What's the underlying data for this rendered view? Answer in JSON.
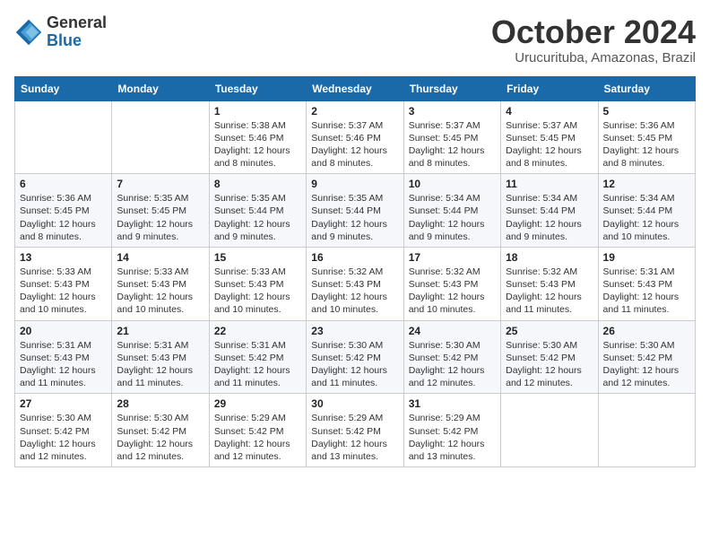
{
  "logo": {
    "general": "General",
    "blue": "Blue"
  },
  "title": "October 2024",
  "subtitle": "Urucurituba, Amazonas, Brazil",
  "headers": [
    "Sunday",
    "Monday",
    "Tuesday",
    "Wednesday",
    "Thursday",
    "Friday",
    "Saturday"
  ],
  "weeks": [
    [
      {
        "day": "",
        "info": ""
      },
      {
        "day": "",
        "info": ""
      },
      {
        "day": "1",
        "info": "Sunrise: 5:38 AM\nSunset: 5:46 PM\nDaylight: 12 hours and 8 minutes."
      },
      {
        "day": "2",
        "info": "Sunrise: 5:37 AM\nSunset: 5:46 PM\nDaylight: 12 hours and 8 minutes."
      },
      {
        "day": "3",
        "info": "Sunrise: 5:37 AM\nSunset: 5:45 PM\nDaylight: 12 hours and 8 minutes."
      },
      {
        "day": "4",
        "info": "Sunrise: 5:37 AM\nSunset: 5:45 PM\nDaylight: 12 hours and 8 minutes."
      },
      {
        "day": "5",
        "info": "Sunrise: 5:36 AM\nSunset: 5:45 PM\nDaylight: 12 hours and 8 minutes."
      }
    ],
    [
      {
        "day": "6",
        "info": "Sunrise: 5:36 AM\nSunset: 5:45 PM\nDaylight: 12 hours and 8 minutes."
      },
      {
        "day": "7",
        "info": "Sunrise: 5:35 AM\nSunset: 5:45 PM\nDaylight: 12 hours and 9 minutes."
      },
      {
        "day": "8",
        "info": "Sunrise: 5:35 AM\nSunset: 5:44 PM\nDaylight: 12 hours and 9 minutes."
      },
      {
        "day": "9",
        "info": "Sunrise: 5:35 AM\nSunset: 5:44 PM\nDaylight: 12 hours and 9 minutes."
      },
      {
        "day": "10",
        "info": "Sunrise: 5:34 AM\nSunset: 5:44 PM\nDaylight: 12 hours and 9 minutes."
      },
      {
        "day": "11",
        "info": "Sunrise: 5:34 AM\nSunset: 5:44 PM\nDaylight: 12 hours and 9 minutes."
      },
      {
        "day": "12",
        "info": "Sunrise: 5:34 AM\nSunset: 5:44 PM\nDaylight: 12 hours and 10 minutes."
      }
    ],
    [
      {
        "day": "13",
        "info": "Sunrise: 5:33 AM\nSunset: 5:43 PM\nDaylight: 12 hours and 10 minutes."
      },
      {
        "day": "14",
        "info": "Sunrise: 5:33 AM\nSunset: 5:43 PM\nDaylight: 12 hours and 10 minutes."
      },
      {
        "day": "15",
        "info": "Sunrise: 5:33 AM\nSunset: 5:43 PM\nDaylight: 12 hours and 10 minutes."
      },
      {
        "day": "16",
        "info": "Sunrise: 5:32 AM\nSunset: 5:43 PM\nDaylight: 12 hours and 10 minutes."
      },
      {
        "day": "17",
        "info": "Sunrise: 5:32 AM\nSunset: 5:43 PM\nDaylight: 12 hours and 10 minutes."
      },
      {
        "day": "18",
        "info": "Sunrise: 5:32 AM\nSunset: 5:43 PM\nDaylight: 12 hours and 11 minutes."
      },
      {
        "day": "19",
        "info": "Sunrise: 5:31 AM\nSunset: 5:43 PM\nDaylight: 12 hours and 11 minutes."
      }
    ],
    [
      {
        "day": "20",
        "info": "Sunrise: 5:31 AM\nSunset: 5:43 PM\nDaylight: 12 hours and 11 minutes."
      },
      {
        "day": "21",
        "info": "Sunrise: 5:31 AM\nSunset: 5:43 PM\nDaylight: 12 hours and 11 minutes."
      },
      {
        "day": "22",
        "info": "Sunrise: 5:31 AM\nSunset: 5:42 PM\nDaylight: 12 hours and 11 minutes."
      },
      {
        "day": "23",
        "info": "Sunrise: 5:30 AM\nSunset: 5:42 PM\nDaylight: 12 hours and 11 minutes."
      },
      {
        "day": "24",
        "info": "Sunrise: 5:30 AM\nSunset: 5:42 PM\nDaylight: 12 hours and 12 minutes."
      },
      {
        "day": "25",
        "info": "Sunrise: 5:30 AM\nSunset: 5:42 PM\nDaylight: 12 hours and 12 minutes."
      },
      {
        "day": "26",
        "info": "Sunrise: 5:30 AM\nSunset: 5:42 PM\nDaylight: 12 hours and 12 minutes."
      }
    ],
    [
      {
        "day": "27",
        "info": "Sunrise: 5:30 AM\nSunset: 5:42 PM\nDaylight: 12 hours and 12 minutes."
      },
      {
        "day": "28",
        "info": "Sunrise: 5:30 AM\nSunset: 5:42 PM\nDaylight: 12 hours and 12 minutes."
      },
      {
        "day": "29",
        "info": "Sunrise: 5:29 AM\nSunset: 5:42 PM\nDaylight: 12 hours and 12 minutes."
      },
      {
        "day": "30",
        "info": "Sunrise: 5:29 AM\nSunset: 5:42 PM\nDaylight: 12 hours and 13 minutes."
      },
      {
        "day": "31",
        "info": "Sunrise: 5:29 AM\nSunset: 5:42 PM\nDaylight: 12 hours and 13 minutes."
      },
      {
        "day": "",
        "info": ""
      },
      {
        "day": "",
        "info": ""
      }
    ]
  ]
}
